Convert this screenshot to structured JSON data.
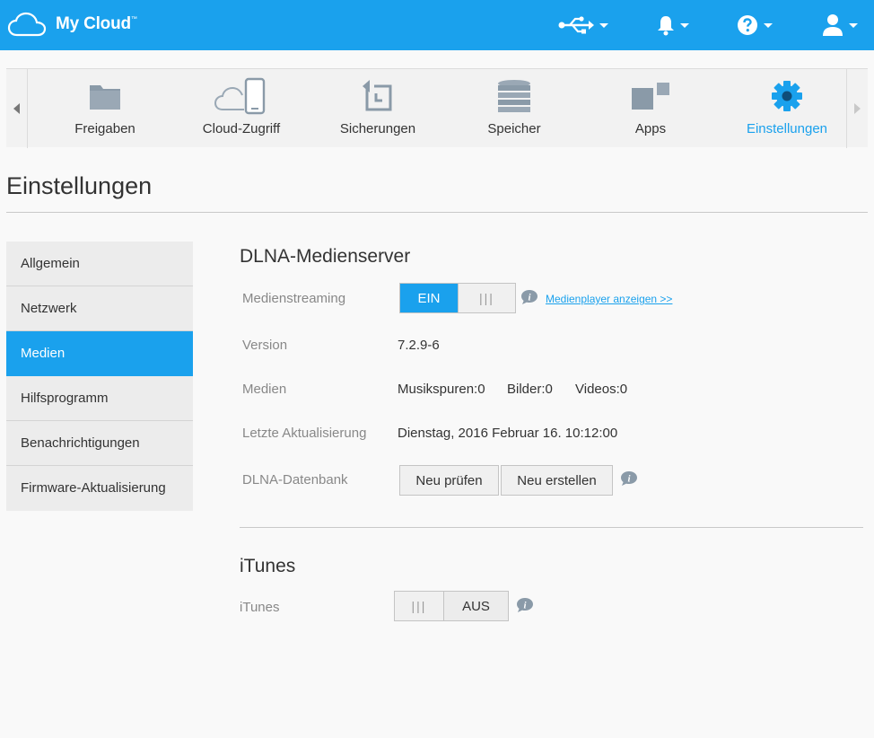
{
  "app": {
    "logo_text": "My Cloud",
    "trademark": "™"
  },
  "nav": {
    "items": [
      {
        "label": "Freigaben",
        "icon": "folder-icon"
      },
      {
        "label": "Cloud-Zugriff",
        "icon": "cloud-device-icon"
      },
      {
        "label": "Sicherungen",
        "icon": "backup-clock-icon"
      },
      {
        "label": "Speicher",
        "icon": "storage-stack-icon"
      },
      {
        "label": "Apps",
        "icon": "apps-grid-icon"
      },
      {
        "label": "Einstellungen",
        "icon": "gear-icon"
      }
    ],
    "active": "Einstellungen"
  },
  "page": {
    "title": "Einstellungen"
  },
  "sidebar": {
    "items": [
      {
        "label": "Allgemein"
      },
      {
        "label": "Netzwerk"
      },
      {
        "label": "Medien"
      },
      {
        "label": "Hilfsprogramm"
      },
      {
        "label": "Benachrichtigungen"
      },
      {
        "label": "Firmware-Aktualisierung"
      }
    ],
    "active": "Medien"
  },
  "dlna": {
    "title": "DLNA-Medienserver",
    "streaming_label": "Medienstreaming",
    "streaming_on": "EIN",
    "streaming_grip": "|||",
    "player_link": "Medienplayer anzeigen >>",
    "version_label": "Version",
    "version_value": "7.2.9-6",
    "media_label": "Medien",
    "music": "Musikspuren:0",
    "pictures": "Bilder:0",
    "videos": "Videos:0",
    "last_update_label": "Letzte Aktualisierung",
    "last_update_value": "Dienstag, 2016 Februar 16. 10:12:00",
    "db_label": "DLNA-Datenbank",
    "rescan_button": "Neu prüfen",
    "rebuild_button": "Neu erstellen"
  },
  "itunes": {
    "title": "iTunes",
    "label": "iTunes",
    "toggle_grip": "|||",
    "toggle_off": "AUS"
  },
  "colors": {
    "accent": "#1aa1ed",
    "nav_icon": "#8a9aa8"
  }
}
